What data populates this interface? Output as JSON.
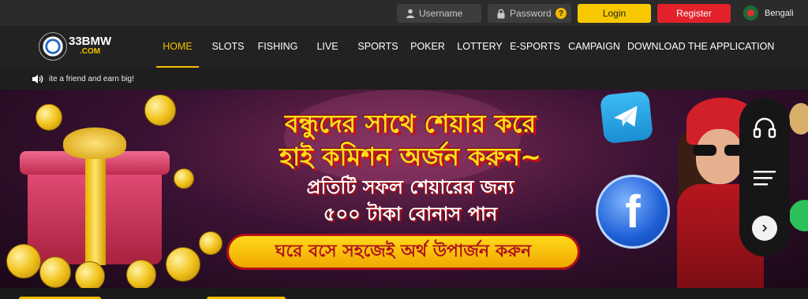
{
  "header": {
    "username_placeholder": "Username",
    "password_placeholder": "Password",
    "help_glyph": "?",
    "login_label": "Login",
    "register_label": "Register",
    "language": "Bengali"
  },
  "logo": {
    "line1": "33BMW",
    "line2": ".COM"
  },
  "nav": {
    "items": [
      {
        "label": "HOME",
        "active": true
      },
      {
        "label": "SLOTS"
      },
      {
        "label": "FISHING"
      },
      {
        "label": "LIVE"
      },
      {
        "label": "SPORTS"
      },
      {
        "label": "POKER"
      },
      {
        "label": "LOTTERY"
      },
      {
        "label": "E-SPORTS"
      },
      {
        "label": "CAMPAIGN"
      },
      {
        "label": "DOWNLOAD THE APPLICATION"
      }
    ]
  },
  "marquee": {
    "text": "ite a friend and earn big!"
  },
  "banner": {
    "line1": "বন্ধুদের সাথে শেয়ার করে",
    "line2": "হাই কমিশন অর্জন করুন~",
    "line3": "প্রতিটি সফল শেয়ারের জন্য",
    "line4": "৫০০ টাকা বোনাস পান",
    "cta": "ঘরে বসে সহজেই অর্থ উপার্জন করুন",
    "fb_glyph": "f"
  },
  "colors": {
    "accent": "#f3c000",
    "login": "#f7c800",
    "register": "#e3212b"
  },
  "icons": [
    "user-icon",
    "lock-icon",
    "help-icon",
    "flag-icon",
    "speaker-icon",
    "telegram-icon",
    "facebook-icon",
    "headset-icon",
    "menu-icon",
    "chevron-right-icon"
  ]
}
